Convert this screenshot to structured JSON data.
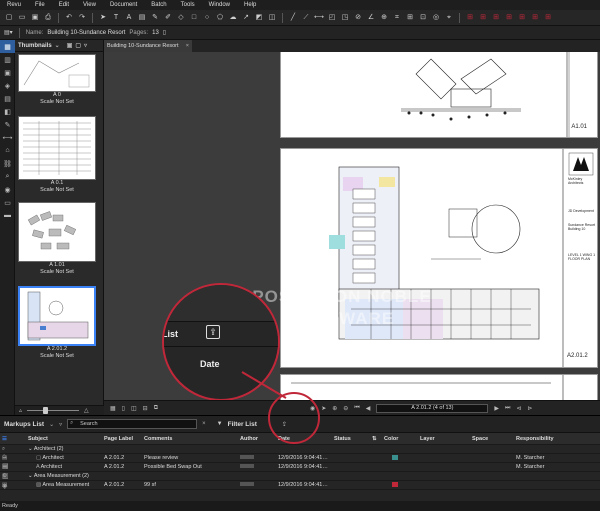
{
  "menu": [
    "Revu",
    "File",
    "Edit",
    "View",
    "Document",
    "Batch",
    "Tools",
    "Window",
    "Help"
  ],
  "namebar": {
    "name_label": "Name:",
    "name_value": "Building 10-Sundance Resort",
    "pages_label": "Pages:",
    "pages_value": "13"
  },
  "thumbnails": {
    "title": "Thumbnails",
    "items": [
      {
        "label": "A 0",
        "scale": "Scale Not Set"
      },
      {
        "label": "A 0.1",
        "scale": "Scale Not Set"
      },
      {
        "label": "A 1.01",
        "scale": "Scale Not Set"
      },
      {
        "label": "A 2.01.2",
        "scale": "Scale Not Set"
      }
    ]
  },
  "document_tab": "Building 10-Sundance Resort",
  "sheet": {
    "title_upper": "A1.01",
    "title_main": "A2.01.2",
    "firm": "McKinley Architects",
    "client": "JD Development",
    "project": "Sundance Resort Building 10",
    "level": "LEVEL 1 WING 1 FLOOR PLAN"
  },
  "nav": {
    "page_indicator": "A 2.01.2 (4 of 13)"
  },
  "callout": {
    "list_fragment": "List",
    "date_label": "Date"
  },
  "watermark": "POSTED ON NOBLE SOFTWARE",
  "markups": {
    "title": "Markups List",
    "search_placeholder": "Search",
    "filter_label": "Filter List",
    "columns": [
      "Subject",
      "Page Label",
      "Comments",
      "Author",
      "Date",
      "Status",
      "Color",
      "Layer",
      "Space",
      "Responsibility"
    ],
    "rows": [
      {
        "type": "group",
        "subject": "Architect (2)"
      },
      {
        "type": "item",
        "subject": "Architect",
        "page": "A 2.01.2",
        "comment": "Please review",
        "author": "",
        "date": "12/9/2016 9:04:41…",
        "color": "#3a8f8f",
        "resp": "M. Starcher"
      },
      {
        "type": "item",
        "subject": "Architect",
        "page": "A 2.01.2",
        "comment": "Possible Bed Swap Out",
        "author": "",
        "date": "12/9/2016 9:04:41…",
        "color": "",
        "resp": "M. Starcher"
      },
      {
        "type": "group",
        "subject": "Area Measurement (2)"
      },
      {
        "type": "item",
        "subject": "Area Measurement",
        "page": "A 2.01.2",
        "comment": "99 sf",
        "author": "",
        "date": "12/9/2016 9:04:41…",
        "color": "#c0283a",
        "resp": ""
      }
    ]
  },
  "status": "Ready",
  "colors": {
    "accent": "#3b82f6",
    "callout": "#c0283a"
  }
}
